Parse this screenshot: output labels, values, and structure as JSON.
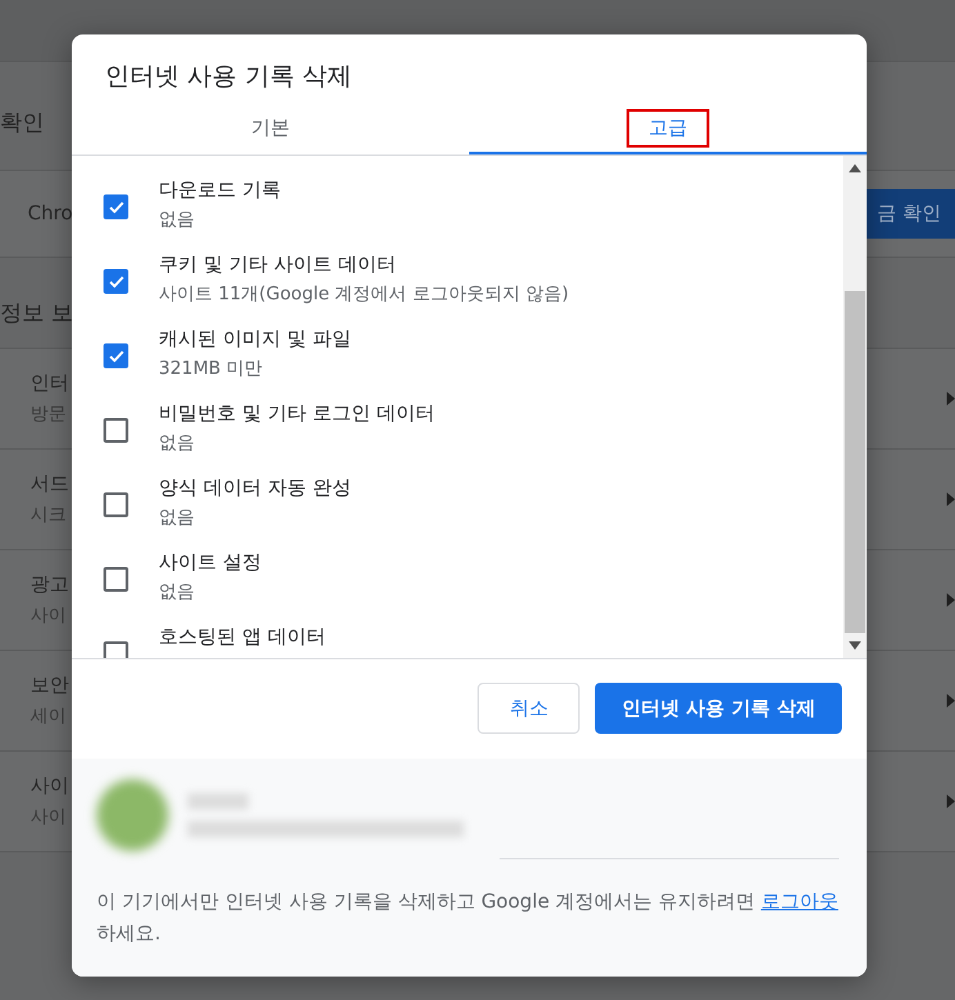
{
  "background_page": {
    "heading": "확인",
    "row_text": "Chro",
    "check_button": "금 확인",
    "section_title": "정보 보",
    "items": [
      {
        "title": "인터",
        "subtitle": "방문"
      },
      {
        "title": "서드",
        "subtitle": "시크"
      },
      {
        "title": "광고",
        "subtitle": "사이"
      },
      {
        "title": "보안",
        "subtitle": "세이"
      },
      {
        "title": "사이",
        "subtitle": "사이"
      }
    ]
  },
  "dialog": {
    "title": "인터넷 사용 기록 삭제",
    "tabs": [
      {
        "label": "기본",
        "selected": false,
        "highlighted": false
      },
      {
        "label": "고급",
        "selected": true,
        "highlighted": true
      }
    ],
    "options": [
      {
        "label": "다운로드 기록",
        "detail": "없음",
        "checked": true
      },
      {
        "label": "쿠키 및 기타 사이트 데이터",
        "detail": "사이트 11개(Google 계정에서 로그아웃되지 않음)",
        "checked": true
      },
      {
        "label": "캐시된 이미지 및 파일",
        "detail": "321MB 미만",
        "checked": true
      },
      {
        "label": "비밀번호 및 기타 로그인 데이터",
        "detail": "없음",
        "checked": false
      },
      {
        "label": "양식 데이터 자동 완성",
        "detail": "없음",
        "checked": false
      },
      {
        "label": "사이트 설정",
        "detail": "없음",
        "checked": false
      },
      {
        "label": "호스팅된 앱 데이터",
        "checked": false
      }
    ],
    "buttons": [
      {
        "kind": "secondary",
        "label": "취소"
      },
      {
        "kind": "primary",
        "label": "인터넷 사용 기록 삭제"
      }
    ],
    "footer": {
      "text_before": "이 기기에서만 인터넷 사용 기록을 삭제하고 Google 계정에서는 유지하려면 ",
      "link": "로그아웃",
      "text_after": "하세요."
    }
  }
}
